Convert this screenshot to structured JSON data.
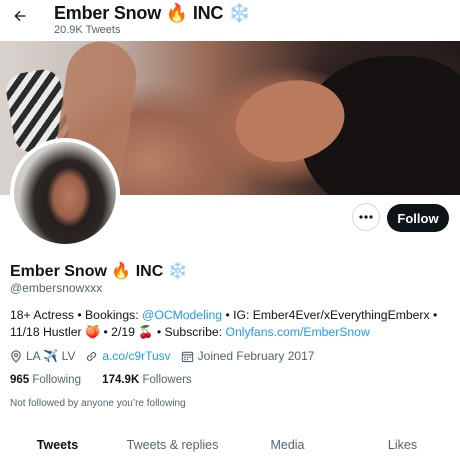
{
  "header": {
    "title": "Ember Snow 🔥 INC ❄️",
    "tweet_count": "20.9K Tweets",
    "back_icon": "arrow-left-icon"
  },
  "profile": {
    "name": "Ember Snow 🔥 INC ❄️",
    "handle": "@embersnowxxx",
    "follow_label": "Follow",
    "more_icon": "ellipsis-icon"
  },
  "bio": {
    "part1": "18+ Actress • Bookings: ",
    "link1": "@OCModeling",
    "part2": " • IG: Ember4Ever/xEverythingEmberx • 11/18 Hustler 🍑 • 2/19 🍒 • Subscribe: ",
    "link2": "Onlyfans.com/EmberSnow"
  },
  "meta": {
    "location": "LA ✈️ LV",
    "url": "a.co/c9rTusv",
    "joined": "Joined February 2017"
  },
  "stats": {
    "following_count": "965",
    "following_label": "Following",
    "followers_count": "174.9K",
    "followers_label": "Followers"
  },
  "not_followed": "Not followed by anyone you’re following",
  "tabs": [
    "Tweets",
    "Tweets & replies",
    "Media",
    "Likes"
  ]
}
